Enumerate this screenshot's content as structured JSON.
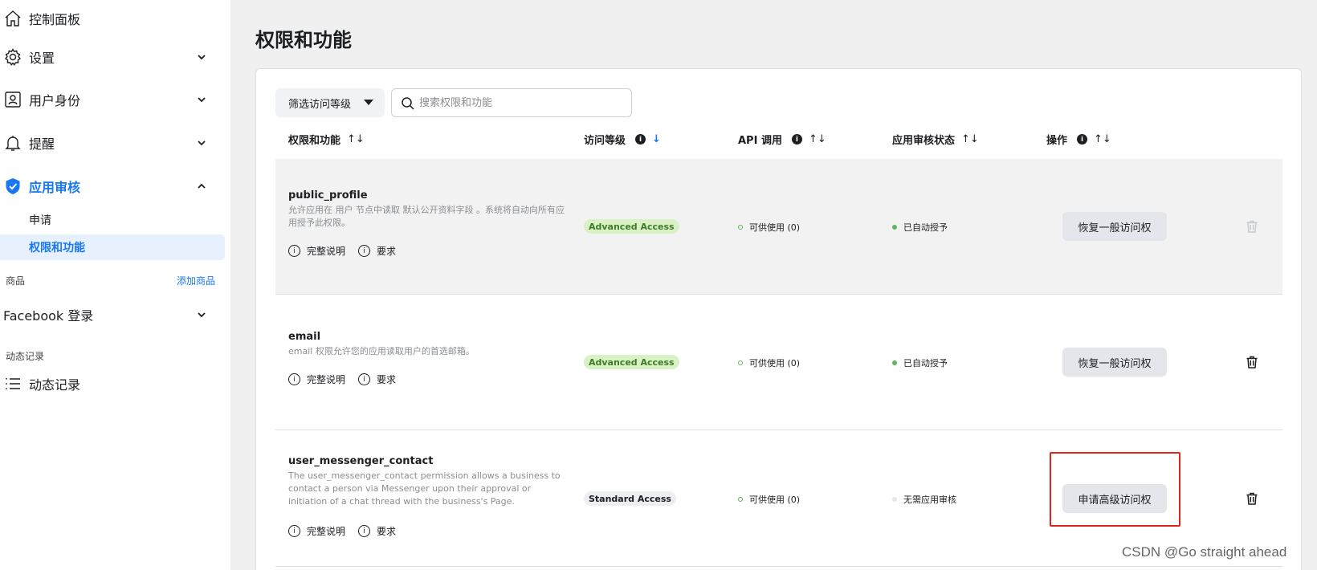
{
  "sidebar": {
    "dashboard": {
      "label": "控制面板",
      "icon": "home-icon"
    },
    "settings": {
      "label": "设置",
      "icon": "gear-icon"
    },
    "roles": {
      "label": "用户身份",
      "icon": "id-badge-icon"
    },
    "alerts": {
      "label": "提醒",
      "icon": "bell-icon"
    },
    "app_review": {
      "label": "应用审核",
      "icon": "shield-check-icon",
      "sub_items": [
        {
          "label": "申请"
        },
        {
          "label": "权限和功能"
        }
      ]
    },
    "products_section": {
      "label": "商品",
      "add_link": "添加商品"
    },
    "fb_login": {
      "label": "Facebook 登录"
    },
    "activity_section": {
      "label": "动态记录"
    },
    "activity_log": {
      "label": "动态记录",
      "icon": "list-icon"
    }
  },
  "main": {
    "title": "权限和功能",
    "filter_label": "筛选访问等级",
    "search_placeholder": "搜索权限和功能",
    "columns": {
      "perm": "权限和功能",
      "access": "访问等级",
      "api": "API 调用",
      "review": "应用审核状态",
      "action": "操作"
    },
    "link_full": "完整说明",
    "link_req": "要求",
    "rows": [
      {
        "name": "public_profile",
        "desc": "允许应用在 用户 节点中读取 默认公开资料字段 。系统将自动向所有应用授予此权限。",
        "access": "Advanced Access",
        "api": "可供使用 (0)",
        "review": "已自动授予",
        "action": "恢复一般访问权"
      },
      {
        "name": "email",
        "desc": "email 权限允许您的应用读取用户的首选邮箱。",
        "access": "Advanced Access",
        "api": "可供使用 (0)",
        "review": "已自动授予",
        "action": "恢复一般访问权"
      },
      {
        "name": "user_messenger_contact",
        "desc": "The user_messenger_contact permission allows a business to contact a person via Messenger upon their approval or initiation of a chat thread with the business's Page.",
        "access": "Standard Access",
        "api": "可供使用 (0)",
        "review": "无需应用审核",
        "action": "申请高级访问权"
      }
    ]
  },
  "watermark": "CSDN @Go straight ahead",
  "colors": {
    "accent": "#1877f2",
    "advanced_badge_bg": "#d9f2c5",
    "status_green": "#5cb85c",
    "highlight_red": "#e0251b"
  }
}
